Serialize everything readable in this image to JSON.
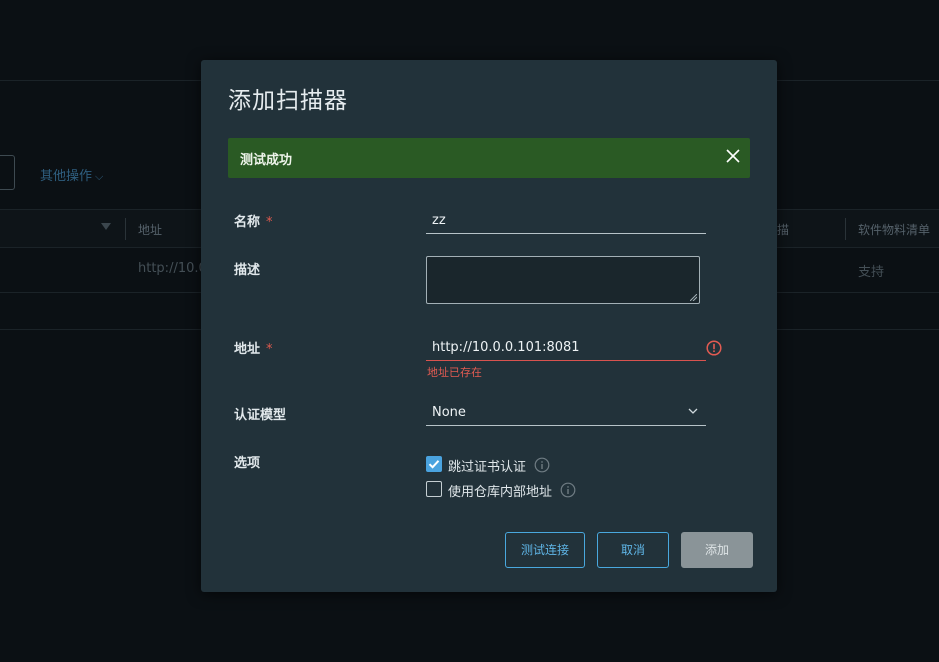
{
  "background": {
    "more_actions": "其他操作",
    "columns": [
      "地址",
      "软件物料清单"
    ],
    "column_partial": "描",
    "row_address": "http://10.0",
    "row_support": "支持"
  },
  "modal": {
    "title": "添加扫描器",
    "alert": {
      "text": "测试成功",
      "color": "#2a5a24"
    },
    "fields": {
      "name": {
        "label": "名称",
        "required_mark": "*",
        "value": "zz"
      },
      "description": {
        "label": "描述",
        "value": ""
      },
      "address": {
        "label": "地址",
        "required_mark": "*",
        "value": "http://10.0.0.101:8081",
        "error": "地址已存在"
      },
      "auth_model": {
        "label": "认证模型",
        "value": "None"
      },
      "options": {
        "label": "选项",
        "items": [
          {
            "label": "跳过证书认证",
            "checked": true
          },
          {
            "label": "使用仓库内部地址",
            "checked": false
          }
        ]
      }
    },
    "buttons": {
      "test": "测试连接",
      "cancel": "取消",
      "add": "添加"
    },
    "colors": {
      "accent": "#49a8de",
      "error": "#d9534f",
      "success": "#2a5a24"
    }
  }
}
